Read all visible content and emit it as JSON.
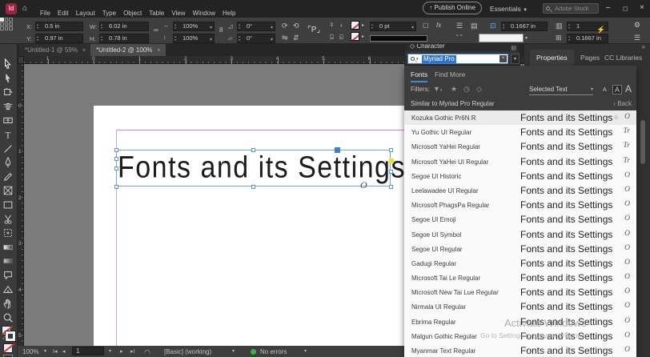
{
  "menubar": {
    "logo": "Id",
    "menus": [
      {
        "name": "menu-file",
        "label": "File"
      },
      {
        "name": "menu-edit",
        "label": "Edit"
      },
      {
        "name": "menu-layout",
        "label": "Layout"
      },
      {
        "name": "menu-type",
        "label": "Type"
      },
      {
        "name": "menu-object",
        "label": "Object"
      },
      {
        "name": "menu-table",
        "label": "Table"
      },
      {
        "name": "menu-view",
        "label": "View"
      },
      {
        "name": "menu-window",
        "label": "Window"
      },
      {
        "name": "menu-help",
        "label": "Help"
      }
    ],
    "publish_online": "Publish Online",
    "workspace": "Essentials",
    "stock_search": "Adobe Stock"
  },
  "control_panel": {
    "x_label": "X:",
    "x_value": "0.5 in",
    "y_label": "Y:",
    "y_value": "0.97 in",
    "w_label": "W:",
    "w_value": "6.02 in",
    "h_label": "H:",
    "h_value": "0.78 in",
    "scale_x": "100%",
    "scale_y": "100%",
    "rotation": "0°",
    "shear": "0°",
    "stroke_weight": "0 pt",
    "inset": "0.1667 in",
    "columns": "1",
    "gutter": "0.1667 in"
  },
  "doc_tabs": [
    {
      "name": "doc-tab-untitled-1",
      "label": "*Untitled-1 @ 59%"
    },
    {
      "name": "doc-tab-untitled-2",
      "label": "*Untitled-2 @ 100%"
    }
  ],
  "rulers": {
    "h_labels": [
      {
        "t": "1",
        "in": -1
      },
      {
        "t": "0",
        "in": 0
      },
      {
        "t": "1",
        "in": 1
      },
      {
        "t": "2",
        "in": 2
      },
      {
        "t": "3",
        "in": 3
      },
      {
        "t": "4",
        "in": 4
      },
      {
        "t": "5",
        "in": 5
      },
      {
        "t": "6",
        "in": 6
      }
    ],
    "v_labels": [
      {
        "t": "0",
        "in": 0
      },
      {
        "t": "1",
        "in": 1
      },
      {
        "t": "2",
        "in": 2
      },
      {
        "t": "3",
        "in": 3
      },
      {
        "t": "4",
        "in": 4
      },
      {
        "t": "5",
        "in": 5
      }
    ]
  },
  "toolbar": {
    "tools": [
      {
        "name": "selection-tool",
        "icon": "arrow-outline"
      },
      {
        "name": "direct-selection-tool",
        "icon": "arrow-filled"
      },
      {
        "name": "page-tool",
        "icon": "page"
      },
      {
        "name": "gap-tool",
        "icon": "gap"
      },
      {
        "name": "content-collector-tool",
        "icon": "collector"
      },
      {
        "name": "type-tool",
        "icon": "type"
      },
      {
        "name": "line-tool",
        "icon": "line"
      },
      {
        "name": "pen-tool",
        "icon": "pen"
      },
      {
        "name": "pencil-tool",
        "icon": "pencil"
      },
      {
        "name": "rectangle-frame-tool",
        "icon": "frame"
      },
      {
        "name": "rectangle-tool",
        "icon": "rect"
      },
      {
        "name": "scissors-tool",
        "icon": "scissors"
      },
      {
        "name": "free-transform-tool",
        "icon": "transform"
      },
      {
        "name": "gradient-swatch-tool",
        "icon": "gradient"
      },
      {
        "name": "gradient-feather-tool",
        "icon": "gradfeather"
      },
      {
        "name": "note-tool",
        "icon": "note"
      },
      {
        "name": "color-theme-tool",
        "icon": "colortheme"
      },
      {
        "name": "hand-tool",
        "icon": "hand"
      },
      {
        "name": "zoom-tool",
        "icon": "zoom"
      }
    ]
  },
  "canvas": {
    "frame_text": "Fonts and its Settings"
  },
  "character_panel": {
    "title": "Character",
    "search_value": "Myriad Pro",
    "tab_fonts": "Fonts",
    "tab_find_more": "Find More",
    "filters_label": "Filters:",
    "selected_text_option": "Selected Text",
    "similar_label": "Similar to Myriad Pro Regular",
    "back_label": "Back",
    "preview_text": "Fonts and its Settings",
    "selected_font": {
      "name": "Kozuka Gothic Pr6N R",
      "icon": "O",
      "extra": "≈  ☆"
    },
    "fonts": [
      {
        "name": "Yu Gothic UI Regular",
        "icon": "Tr"
      },
      {
        "name": "Microsoft YaHei Regular",
        "icon": "Tr"
      },
      {
        "name": "Microsoft YaHei UI Regular",
        "icon": "Tr"
      },
      {
        "name": "Segoe UI Historic",
        "icon": "O"
      },
      {
        "name": "Leelawadee UI Regular",
        "icon": "O"
      },
      {
        "name": "Microsoft PhagsPa Regular",
        "icon": "O"
      },
      {
        "name": "Segoe UI Emoji",
        "icon": "O"
      },
      {
        "name": "Segoe UI Symbol",
        "icon": "O"
      },
      {
        "name": "Segoe UI Regular",
        "icon": "O"
      },
      {
        "name": "Gadugi Regular",
        "icon": "O"
      },
      {
        "name": "Microsoft Tai Le Regular",
        "icon": "O"
      },
      {
        "name": "Microsoft New Tai Lue Regular",
        "icon": "O"
      },
      {
        "name": "Nirmala UI Regular",
        "icon": "O"
      },
      {
        "name": "Ebrima Regular",
        "icon": "O"
      },
      {
        "name": "Malgun Gothic Regular",
        "icon": "O"
      },
      {
        "name": "Myanmar Text Regular",
        "icon": "O"
      }
    ]
  },
  "properties_panel": {
    "tab_properties": "Properties",
    "tab_pages": "Pages",
    "tab_cc": "CC Libraries"
  },
  "status_bar": {
    "zoom": "100%",
    "page_number": "1",
    "preflight_profile": "[Basic] (working)",
    "errors": "No errors"
  },
  "watermark": {
    "line1": "Activate Windows",
    "line2": "Go to Settings to activate Windows."
  }
}
